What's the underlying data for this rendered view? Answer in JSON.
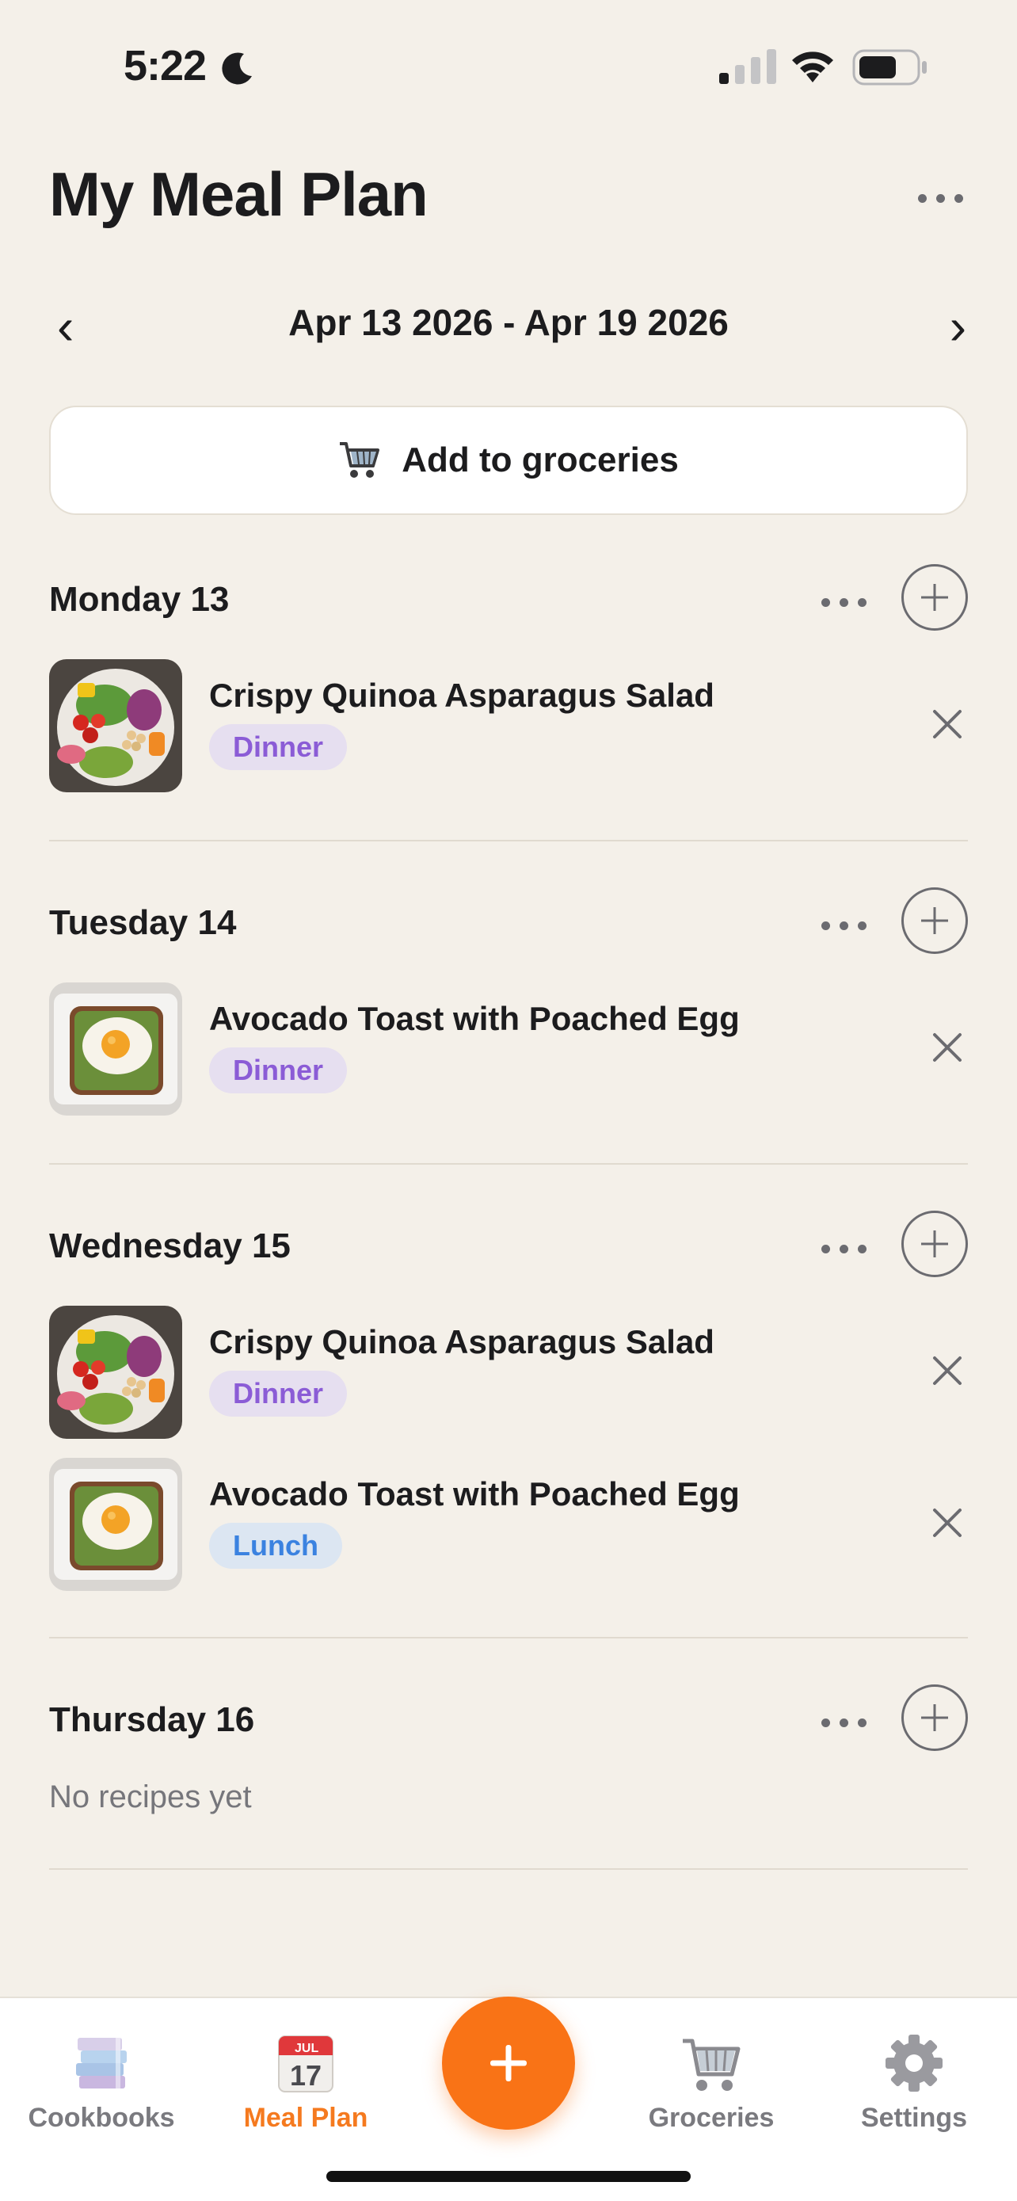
{
  "status_bar": {
    "time": "5:22",
    "icons": [
      "moon-icon",
      "signal-icon",
      "wifi-icon",
      "battery-icon"
    ]
  },
  "header": {
    "title": "My Meal Plan",
    "more_icon": "ellipsis-icon"
  },
  "week_nav": {
    "range": "Apr 13 2026 - Apr 19 2026",
    "prev": "‹",
    "next": "›"
  },
  "groceries_button": {
    "icon": "cart-icon",
    "label": "Add to groceries"
  },
  "days": [
    {
      "title": "Monday 13",
      "meals": [
        {
          "name": "Crispy Quinoa Asparagus Salad",
          "tag": "Dinner",
          "thumb": "salad"
        }
      ]
    },
    {
      "title": "Tuesday 14",
      "meals": [
        {
          "name": "Avocado Toast with Poached Egg",
          "tag": "Dinner",
          "thumb": "toast"
        }
      ]
    },
    {
      "title": "Wednesday 15",
      "meals": [
        {
          "name": "Crispy Quinoa Asparagus Salad",
          "tag": "Dinner",
          "thumb": "salad"
        },
        {
          "name": "Avocado Toast with Poached Egg",
          "tag": "Lunch",
          "thumb": "toast"
        }
      ]
    },
    {
      "title": "Thursday 16",
      "meals": [],
      "empty_text": "No recipes yet"
    }
  ],
  "tab_bar": {
    "tabs": [
      {
        "label": "Cookbooks",
        "icon": "books-icon",
        "active": false
      },
      {
        "label": "Meal Plan",
        "icon": "calendar-icon",
        "active": true
      },
      {
        "label": "Groceries",
        "icon": "cart-icon",
        "active": false
      },
      {
        "label": "Settings",
        "icon": "gear-icon",
        "active": false
      }
    ],
    "calendar_month": "JUL",
    "calendar_day": "17",
    "fab_icon": "plus-icon"
  },
  "colors": {
    "background": "#f4f0e9",
    "accent": "#f97316",
    "dinner_tag": "#8b5cd6",
    "lunch_tag": "#3b82e0"
  }
}
